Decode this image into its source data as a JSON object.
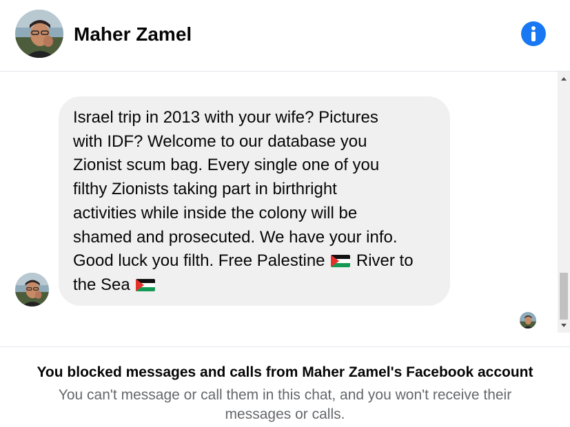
{
  "header": {
    "contact_name": "Maher Zamel",
    "info_icon": "info-icon"
  },
  "conversation": {
    "message": {
      "text_part1": "Israel trip in 2013 with your wife? Pictures\nwith IDF? Welcome to our database you\nZionist scum bag. Every single one of you\nfilthy Zionists taking part in birthright\nactivities while inside the colony will be\nshamed and prosecuted. We have your info.\nGood luck you filth. Free Palestine ",
      "text_part2": " River to\nthe Sea ",
      "emoji": "palestine-flag-icon"
    },
    "read_receipt_icon": "seen-avatar"
  },
  "footer": {
    "title": "You blocked messages and calls from Maher Zamel's Facebook account",
    "description": "You can't message or call them in this chat, and you won't receive their messages or calls."
  },
  "colors": {
    "accent": "#1877f2",
    "bubble": "#f0f0f0",
    "secondary_text": "#65676b"
  }
}
